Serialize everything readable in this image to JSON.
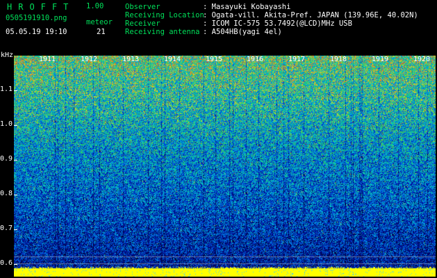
{
  "header": {
    "app_name": "HROFFT",
    "version": "1.00",
    "filename": "0505191910.png",
    "datetime": "05.05.19 19:10",
    "meteor_label": "meteor",
    "meteor_count": "21"
  },
  "info": [
    {
      "label": "Observer",
      "value": ": Masayuki Kobayashi"
    },
    {
      "label": "Receiving Location",
      "value": ": Ogata-vill. Akita-Pref. JAPAN (139.96E, 40.02N)"
    },
    {
      "label": "Receiver",
      "value": ": ICOM IC-575 53.7492(@LCD)MHz USB"
    },
    {
      "label": "Receiving antenna",
      "value": ": A504HB(yagi 4el)"
    }
  ],
  "axis": {
    "y_unit": "kHz",
    "y_ticks": [
      "1.1",
      "1.0",
      "0.9",
      "0.8",
      "0.7",
      "0.6"
    ],
    "x_ticks": [
      "1911",
      "1912",
      "1913",
      "1914",
      "1915",
      "1916",
      "1917",
      "1918",
      "1919",
      "1920"
    ]
  },
  "colors": {
    "background": "#000000",
    "label_green": "#00e05a",
    "text_white": "#ffffff",
    "noise_floor": "#ffff00"
  }
}
